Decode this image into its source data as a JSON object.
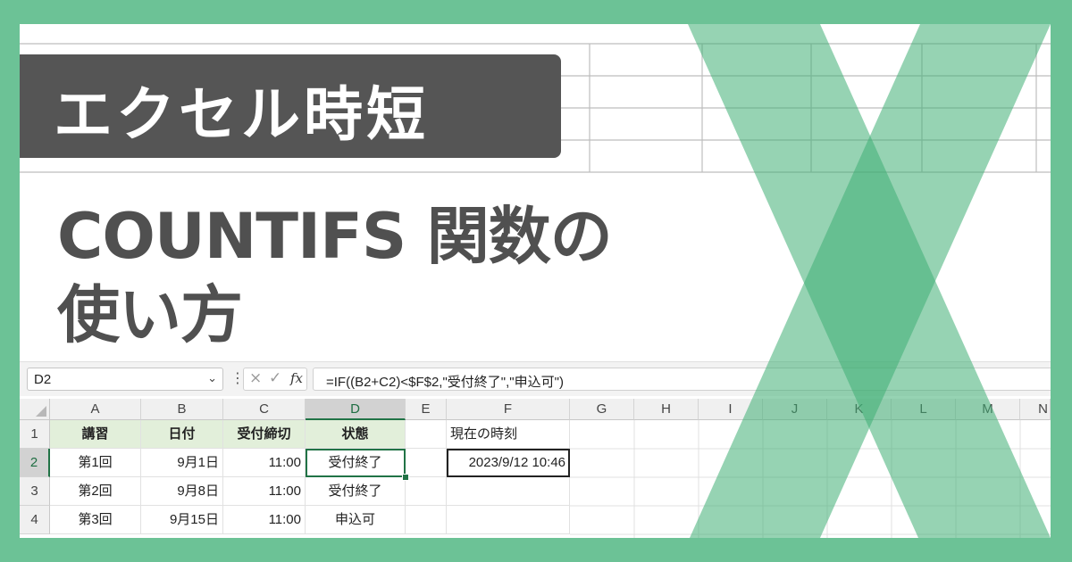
{
  "banner": {
    "title": "エクセル時短"
  },
  "headline": {
    "line1": "COUNTIFS 関数の",
    "line2": "使い方"
  },
  "formula_bar": {
    "name_box": "D2",
    "formula": "=IF((B2+C2)<$F$2,\"受付終了\",\"申込可\")",
    "cancel_icon": "×",
    "enter_icon": "✓",
    "fx_label": "fx",
    "dots": "⋮",
    "dropdown_icon": "⌄"
  },
  "columns": [
    "A",
    "B",
    "C",
    "D",
    "E",
    "F",
    "G",
    "H",
    "I",
    "J",
    "K",
    "L",
    "M",
    "N"
  ],
  "rows": [
    "1",
    "2",
    "3",
    "4"
  ],
  "table": {
    "headers": [
      "講習",
      "日付",
      "受付締切",
      "状態"
    ],
    "rows": [
      [
        "第1回",
        "9月1日",
        "11:00",
        "受付終了"
      ],
      [
        "第2回",
        "9月8日",
        "11:00",
        "受付終了"
      ],
      [
        "第3回",
        "9月15日",
        "11:00",
        "申込可"
      ]
    ]
  },
  "side": {
    "label": "現在の時刻",
    "value": "2023/9/12 10:46"
  },
  "colors": {
    "frame": "#6cc296",
    "accent": "#217346",
    "header_fill": "#e2efda",
    "banner": "#555555",
    "logo": "#3fae74"
  },
  "icons": {
    "logo": "excel-x-logo-icon"
  }
}
